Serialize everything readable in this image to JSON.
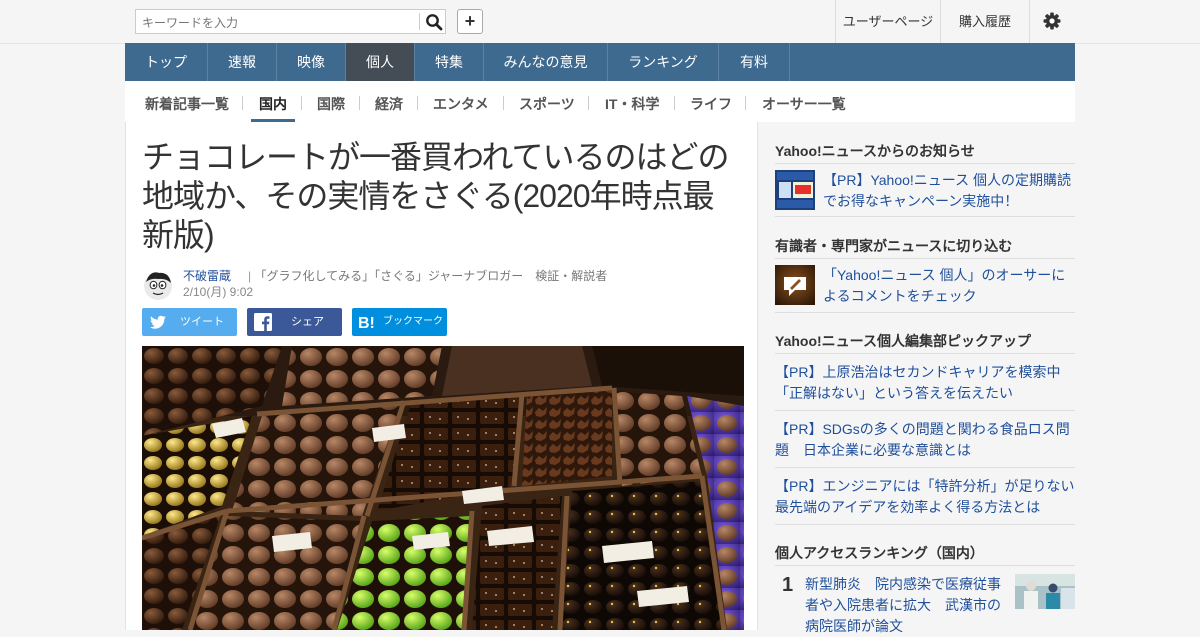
{
  "header": {
    "search_placeholder": "キーワードを入力",
    "user_page": "ユーザーページ",
    "purchase_history": "購入履歴"
  },
  "nav": [
    "トップ",
    "速報",
    "映像",
    "個人",
    "特集",
    "みんなの意見",
    "ランキング",
    "有料"
  ],
  "nav_active": "個人",
  "subnav": [
    "新着記事一覧",
    "国内",
    "国際",
    "経済",
    "エンタメ",
    "スポーツ",
    "IT・科学",
    "ライフ",
    "オーサー一覧"
  ],
  "subnav_active": "国内",
  "article": {
    "title": "チョコレートが一番買われているのはどの地域か、その実情をさぐる(2020年時点最新版)",
    "author_name": "不破雷蔵",
    "author_desc": "「グラフ化してみる」「さぐる」ジャーナブロガー　検証・解説者",
    "date": "2/10(月) 9:02",
    "share": {
      "tweet": "ツイート",
      "share": "シェア",
      "hatena": "ブックマーク"
    }
  },
  "sidebar": {
    "notice_heading": "Yahoo!ニュースからのお知らせ",
    "notice_link": "【PR】Yahoo!ニュース 個人の定期購読でお得なキャンペーン実施中！",
    "experts_heading": "有識者・専門家がニュースに切り込む",
    "experts_link": "「Yahoo!ニュース 個人」のオーサーによるコメントをチェック",
    "pickup_heading": "Yahoo!ニュース個人編集部ピックアップ",
    "pickup_links": [
      "【PR】上原浩治はセカンドキャリアを模索中「正解はない」という答えを伝えたい",
      "【PR】SDGsの多くの問題と関わる食品ロス問題　日本企業に必要な意識とは",
      "【PR】エンジニアには「特許分析」が足りない　最先端のアイデアを効率よく得る方法とは"
    ],
    "ranking_heading": "個人アクセスランキング（国内）",
    "ranking": [
      {
        "rank": "1",
        "title": "新型肺炎　院内感染で医療従事者や入院患者に拡大　武漢市の病院医師が論文"
      }
    ]
  },
  "colors": {
    "nav_bg": "#3e6a90",
    "nav_active": "#444d55",
    "link": "#1f4f9b",
    "twitter": "#55acee",
    "facebook": "#3b5998",
    "hatena": "#008fde"
  }
}
